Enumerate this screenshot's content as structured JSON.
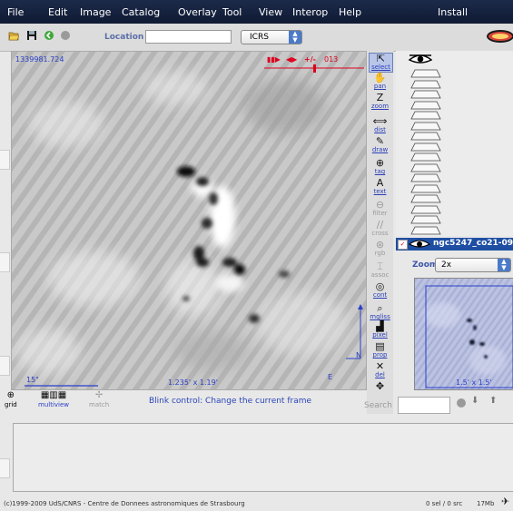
{
  "menubar": {
    "items": [
      "File",
      "Edit",
      "Image",
      "Catalog",
      "Overlay",
      "Tool",
      "View",
      "Interop",
      "Help"
    ],
    "install_label": "Install"
  },
  "toolbar": {
    "location_label": "Location",
    "location_value": "",
    "frame_value": "ICRS"
  },
  "image": {
    "frame_id": "1339981.724",
    "blink_frame": "013",
    "blink_sep": "+/-",
    "scale_label": "15\"",
    "size_label": "1.235' x 1.19'",
    "north": "N",
    "east": "E"
  },
  "tools": [
    {
      "id": "select",
      "label": "select",
      "icon": "pointer-icon",
      "glyph": "⇱",
      "selected": true
    },
    {
      "id": "pan",
      "label": "pan",
      "icon": "hand-icon",
      "glyph": "✋"
    },
    {
      "id": "zoom",
      "label": "zoom",
      "icon": "zoom-icon",
      "glyph": "Z"
    },
    {
      "id": "dist",
      "label": "dist",
      "icon": "distance-icon",
      "glyph": "⟺"
    },
    {
      "id": "draw",
      "label": "draw",
      "icon": "pen-icon",
      "glyph": "✎"
    },
    {
      "id": "tag",
      "label": "tag",
      "icon": "tag-icon",
      "glyph": "⊕"
    },
    {
      "id": "text",
      "label": "text",
      "icon": "text-icon",
      "glyph": "A"
    },
    {
      "id": "filter",
      "label": "filter",
      "icon": "filter-icon",
      "glyph": "⊖",
      "disabled": true
    },
    {
      "id": "cross",
      "label": "cross",
      "icon": "cross-icon",
      "glyph": "∕∕",
      "disabled": true
    },
    {
      "id": "rgb",
      "label": "rgb",
      "icon": "rgb-icon",
      "glyph": "⊛",
      "disabled": true
    },
    {
      "id": "assoc",
      "label": "assoc",
      "icon": "assoc-icon",
      "glyph": "⌶",
      "disabled": true
    },
    {
      "id": "cont",
      "label": "cont",
      "icon": "contour-icon",
      "glyph": "◎"
    },
    {
      "id": "mgliss",
      "label": "mgliss",
      "icon": "magnifier-icon",
      "glyph": "⌕"
    },
    {
      "id": "pixel",
      "label": "pixel",
      "icon": "pixel-icon",
      "glyph": "▟"
    },
    {
      "id": "prop",
      "label": "prop",
      "icon": "properties-icon",
      "glyph": "▤"
    },
    {
      "id": "del",
      "label": "del",
      "icon": "delete-icon",
      "glyph": "✕"
    }
  ],
  "stack": {
    "layer_name": "ngc5247_co21-09",
    "plane_count": 16
  },
  "zoom": {
    "label": "Zoom",
    "value": "2x",
    "size_label": "1.5' x 1.5'"
  },
  "viewtools": {
    "grid_label": "grid",
    "multiview_label": "multiview",
    "match_label": "match"
  },
  "status": {
    "blink_message": "Blink control: Change the current frame",
    "search_label": "Search",
    "search_value": "",
    "copyright": "(c)1999-2009 UdS/CNRS - Centre de Donnees astronomiques de Strasbourg",
    "selection": "0 sel / 0 src",
    "memory": "17Mb"
  },
  "colors": {
    "menubar_bg": "#0f1a33",
    "accent_blue": "#2b45b8",
    "blink_red": "#e0001c"
  }
}
